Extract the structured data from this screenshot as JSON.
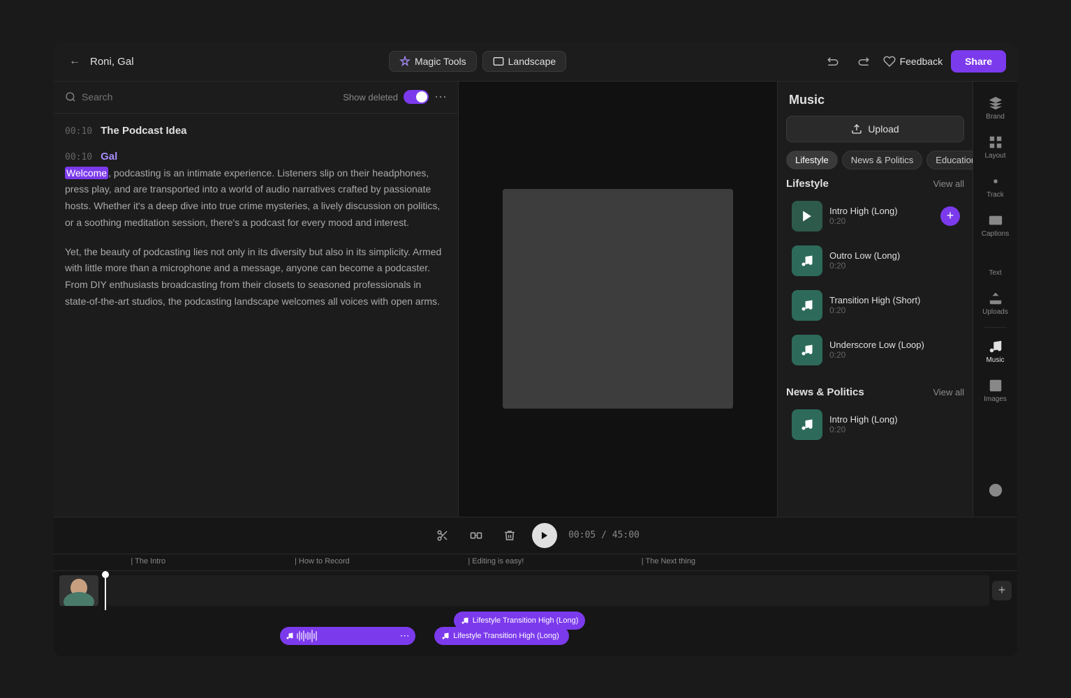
{
  "app": {
    "project_title": "Roni, Gal",
    "magic_tools_label": "Magic Tools",
    "landscape_label": "Landscape",
    "feedback_label": "Feedback",
    "share_label": "Share"
  },
  "toolbar": {
    "search_placeholder": "Search",
    "show_deleted_label": "Show deleted"
  },
  "transcript": {
    "section1": {
      "timestamp": "00:10",
      "title": "The Podcast Idea"
    },
    "section2": {
      "timestamp": "00:10",
      "speaker": "Gal",
      "text1": "Welcome, podcasting is an intimate experience. Listeners slip on their headphones, press play, and are transported into a world of audio narratives crafted by passionate hosts. Whether it's a deep dive into true crime mysteries, a lively discussion on politics, or a soothing meditation session, there's a podcast for every mood and interest.",
      "text2": "Yet, the beauty of podcasting lies not only in its diversity but also in its simplicity. Armed with little more than a microphone and a message, anyone can become a podcaster. From DIY enthusiasts broadcasting from their closets to seasoned professionals in state-of-the-art studios, the podcasting landscape welcomes all voices with open arms."
    }
  },
  "playback": {
    "current_time": "00:05",
    "total_time": "45:00"
  },
  "timeline": {
    "markers": [
      {
        "label": "The Intro",
        "pos": 8
      },
      {
        "label": "How to Record",
        "pos": 25
      },
      {
        "label": "Editing is easy!",
        "pos": 43
      },
      {
        "label": "The Next thing",
        "pos": 61
      }
    ],
    "music_tracks": [
      {
        "label": "Lifestyle Transition High (Long)",
        "left": "38%",
        "width": "15%"
      },
      {
        "label": "Lifestyle Transition High (Long)",
        "left": "44%",
        "width": "15%"
      }
    ]
  },
  "music": {
    "panel_title": "Music",
    "upload_label": "Upload",
    "tabs": [
      {
        "label": "Lifestyle",
        "active": true
      },
      {
        "label": "News & Politics",
        "active": false
      },
      {
        "label": "Education",
        "active": false
      }
    ],
    "lifestyle_section": {
      "title": "Lifestyle",
      "view_all": "View all",
      "items": [
        {
          "name": "Intro High (Long)",
          "duration": "0:20",
          "playing": true
        },
        {
          "name": "Outro Low (Long)",
          "duration": "0:20",
          "playing": false
        },
        {
          "name": "Transition High (Short)",
          "duration": "0:20",
          "playing": false
        },
        {
          "name": "Underscore Low (Loop)",
          "duration": "0:20",
          "playing": false
        }
      ]
    },
    "news_section": {
      "title": "News & Politics",
      "view_all": "View all",
      "items": [
        {
          "name": "Intro High (Long)",
          "duration": "0:20",
          "playing": false
        }
      ]
    }
  },
  "icon_bar": {
    "items": [
      {
        "label": "Brand",
        "icon": "brand"
      },
      {
        "label": "Layout",
        "icon": "layout"
      },
      {
        "label": "Track",
        "icon": "track"
      },
      {
        "label": "Captions",
        "icon": "captions"
      },
      {
        "label": "Text",
        "icon": "text"
      },
      {
        "label": "Uploads",
        "icon": "uploads"
      },
      {
        "label": "Music",
        "icon": "music",
        "active": true
      },
      {
        "label": "Images",
        "icon": "images"
      },
      {
        "label": "Help",
        "icon": "help"
      }
    ]
  }
}
